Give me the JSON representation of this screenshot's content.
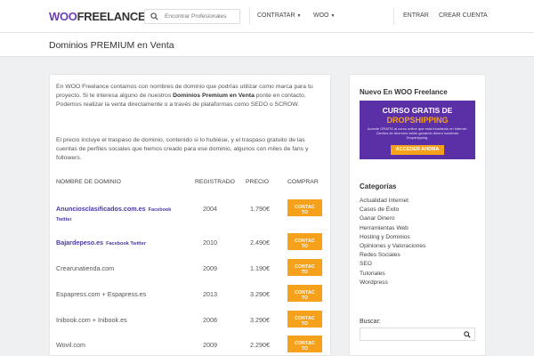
{
  "header": {
    "logo_woo": "WOO",
    "logo_freelance": "FREELANCE",
    "search_placeholder": "Encontrar Profesionales",
    "nav": [
      {
        "label": "CONTRATAR",
        "has_caret": true
      },
      {
        "label": "WOO",
        "has_caret": true
      },
      {
        "label": "ENTRAR"
      },
      {
        "label": "CREAR CUENTA"
      }
    ],
    "caret": "▼"
  },
  "page_title": "Dominios PREMIUM en Venta",
  "intro": {
    "part1": "En WOO Freelance contamos con nombres de dominio que podrías utilizar como marca para tu proyecto. Si te interesa alguno de nuestros ",
    "bold": "Dominios Premium en Venta",
    "part2": " ponte en contacto. Podemos realizar la venta directamente o a través de plataformas como SEDO o SCROW.",
    "paragraph2": "El precio incluye el traspaso de dominio, contenido si lo hubiése, y el traspaso gratuito de las cuentas de perfiles sociales que hemos creado para ese dominio, algunos con miles de fans y followers."
  },
  "table": {
    "headers": {
      "domain": "NOMBRE DE DOMINIO",
      "registered": "REGISTRADO",
      "price": "PRECIO",
      "buy": "COMPRAR"
    },
    "button_label_line1": "CONTAC",
    "button_label_line2": "TO",
    "rows": [
      {
        "domain": "Anunciosclasificados.com.es",
        "extra": "Facebook",
        "extra2": "Twitter",
        "year": "2004",
        "price": "1.790€",
        "link": true
      },
      {
        "domain": "Bajardepeso.es",
        "extra": "Facebook Twitter",
        "year": "2010",
        "price": "2.490€",
        "link": true
      },
      {
        "domain": "Crearunatienda.com",
        "year": "2009",
        "price": "1.190€",
        "link": false
      },
      {
        "domain": "Espapress.com + Espapress.es",
        "year": "2013",
        "price": "3.290€",
        "link": false
      },
      {
        "domain": "Inibook.com + Inibook.es",
        "year": "2008",
        "price": "3.290€",
        "link": false
      },
      {
        "domain": "Wovil.com",
        "year": "2009",
        "price": "2.290€",
        "link": false
      }
    ]
  },
  "sidebar": {
    "new_title": "Nuevo En WOO Freelance",
    "banner": {
      "line1": "CURSO GRATIS DE",
      "line2": "DROPSHIPPING",
      "line3": "Accede GRATIS al curso online que está triunfando en internet. Cientos de Alumnos están ganando dinero haciendo Dropshipping.",
      "button": "ACCEDER AHORA"
    },
    "categories_title": "Categorías",
    "categories": [
      "Actualidad Internet",
      "Casos de Éxito",
      "Ganar Dinero",
      "Herramientas Web",
      "Hosting y Dominios",
      "Opiniones y Valoraciones",
      "Redes Sociales",
      "SEO",
      "Tutoriales",
      "Wordpress"
    ],
    "search_title": "Buscar:"
  },
  "colors": {
    "brand": "#6a3fb5",
    "accent": "#f5a11b",
    "link": "#4a3aa0"
  }
}
